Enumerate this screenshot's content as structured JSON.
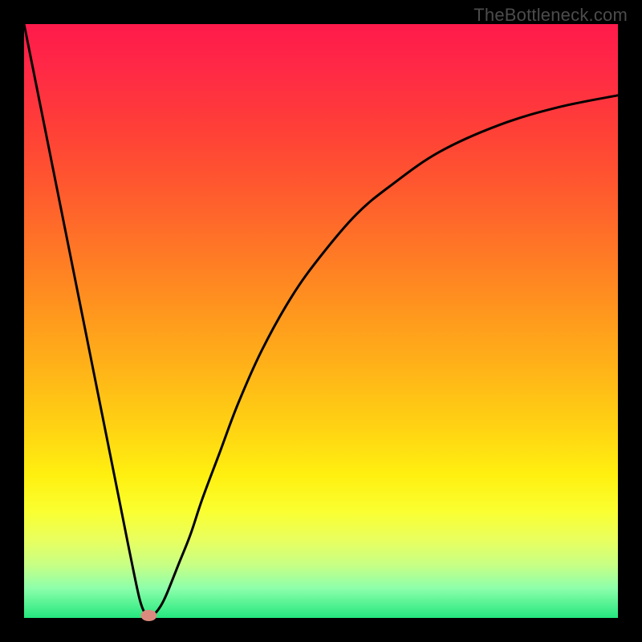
{
  "watermark": "TheBottleneck.com",
  "chart_data": {
    "type": "line",
    "title": "",
    "xlabel": "",
    "ylabel": "",
    "xlim": [
      0,
      100
    ],
    "ylim": [
      0,
      100
    ],
    "grid": false,
    "legend": false,
    "series": [
      {
        "name": "curve",
        "color": "#000000",
        "x": [
          0,
          4,
          8,
          12,
          16,
          18,
          19.5,
          20.5,
          21,
          22,
          23,
          24,
          26,
          28,
          30,
          33,
          36,
          40,
          45,
          50,
          56,
          62,
          70,
          80,
          90,
          100
        ],
        "y": [
          100,
          80,
          60,
          40,
          20,
          10,
          3,
          0.5,
          0,
          0.7,
          2,
          4,
          9,
          14,
          20,
          28,
          36,
          45,
          54,
          61,
          68,
          73,
          78.5,
          83,
          86,
          88
        ]
      }
    ],
    "marker": {
      "name": "bottleneck-point",
      "x": 21,
      "y": 0,
      "color": "#dd8a7e"
    }
  }
}
